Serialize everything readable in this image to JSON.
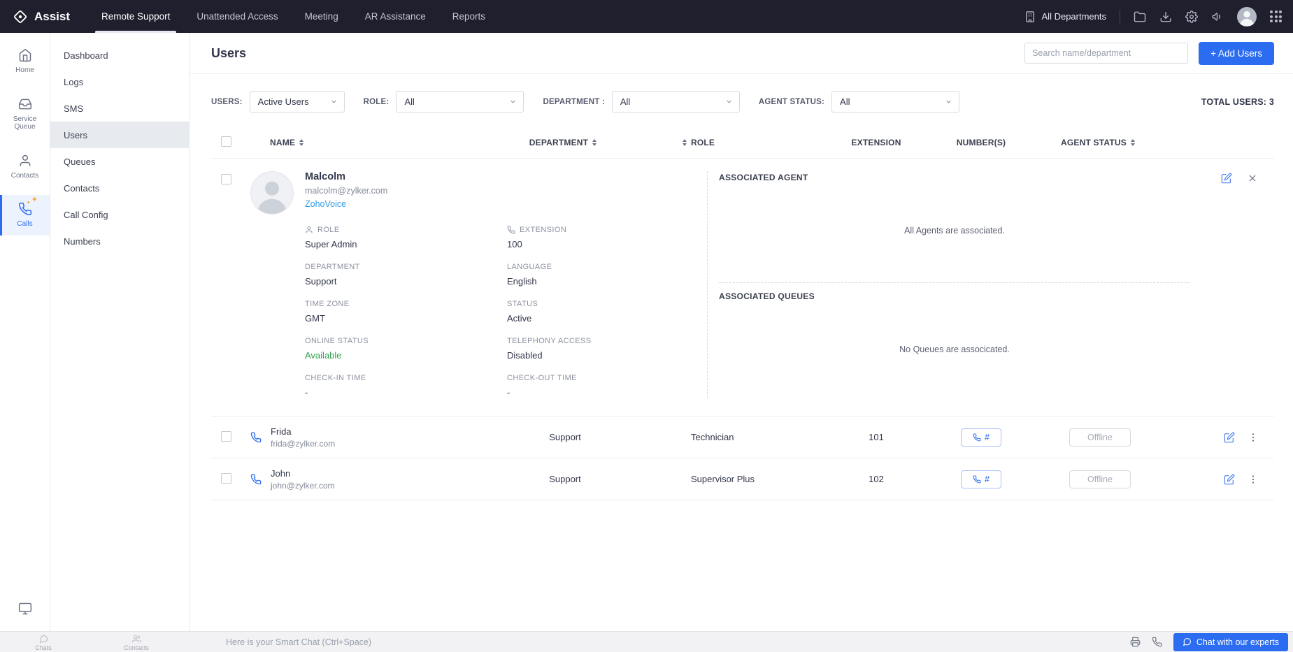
{
  "topbar": {
    "brand": "Assist",
    "nav": [
      {
        "label": "Remote Support",
        "active": true
      },
      {
        "label": "Unattended Access",
        "active": false
      },
      {
        "label": "Meeting",
        "active": false
      },
      {
        "label": "AR Assistance",
        "active": false
      },
      {
        "label": "Reports",
        "active": false
      }
    ],
    "departments": "All Departments"
  },
  "rail": {
    "items": [
      {
        "label": "Home",
        "active": false
      },
      {
        "label": "Service Queue",
        "active": false
      },
      {
        "label": "Contacts",
        "active": false
      },
      {
        "label": "Calls",
        "active": true
      }
    ]
  },
  "sidebar": {
    "items": [
      {
        "label": "Dashboard",
        "active": false
      },
      {
        "label": "Logs",
        "active": false
      },
      {
        "label": "SMS",
        "active": false
      },
      {
        "label": "Users",
        "active": true
      },
      {
        "label": "Queues",
        "active": false
      },
      {
        "label": "Contacts",
        "active": false
      },
      {
        "label": "Call Config",
        "active": false
      },
      {
        "label": "Numbers",
        "active": false
      }
    ]
  },
  "header": {
    "title": "Users",
    "search_placeholder": "Search name/department",
    "add_button": "+ Add Users"
  },
  "filters": {
    "users": {
      "label": "USERS:",
      "value": "Active Users"
    },
    "role": {
      "label": "ROLE:",
      "value": "All"
    },
    "department": {
      "label": "DEPARTMENT :",
      "value": "All"
    },
    "agent_status": {
      "label": "AGENT STATUS:",
      "value": "All"
    },
    "total": "TOTAL USERS: 3"
  },
  "table": {
    "columns": {
      "name": "NAME",
      "department": "DEPARTMENT",
      "role": "ROLE",
      "extension": "EXTENSION",
      "numbers": "NUMBER(S)",
      "agent_status": "AGENT STATUS"
    },
    "number_button_label": "#",
    "expanded_user": {
      "name": "Malcolm",
      "email": "malcolm@zylker.com",
      "link": "ZohoVoice",
      "fields": [
        {
          "label": "ROLE",
          "value": "Super Admin"
        },
        {
          "label": "EXTENSION",
          "value": "100"
        },
        {
          "label": "DEPARTMENT",
          "value": "Support"
        },
        {
          "label": "LANGUAGE",
          "value": "English"
        },
        {
          "label": "TIME ZONE",
          "value": "GMT"
        },
        {
          "label": "STATUS",
          "value": "Active"
        },
        {
          "label": "ONLINE STATUS",
          "value": "Available"
        },
        {
          "label": "TELEPHONY ACCESS",
          "value": "Disabled"
        },
        {
          "label": "CHECK-IN TIME",
          "value": "-"
        },
        {
          "label": "CHECK-OUT TIME",
          "value": "-"
        }
      ],
      "associated_agent": {
        "title": "ASSOCIATED AGENT",
        "text": "All Agents are associated."
      },
      "associated_queues": {
        "title": "ASSOCIATED QUEUES",
        "text": "No Queues are associcated."
      }
    },
    "rows": [
      {
        "name": "Frida",
        "email": "frida@zylker.com",
        "department": "Support",
        "role": "Technician",
        "extension": "101",
        "agent_status": "Offline"
      },
      {
        "name": "John",
        "email": "john@zylker.com",
        "department": "Support",
        "role": "Supervisor Plus",
        "extension": "102",
        "agent_status": "Offline"
      }
    ]
  },
  "bottombar": {
    "taskbar": [
      {
        "label": "Chats"
      },
      {
        "label": "Contacts"
      }
    ],
    "chat_placeholder": "Here is your Smart Chat (Ctrl+Space)",
    "experts_button": "Chat with our experts"
  },
  "colors": {
    "topbar_bg": "#1f1f2e",
    "accent_blue": "#2b6cf0",
    "link_blue": "#2e9be5",
    "success_green": "#2fa24f"
  }
}
